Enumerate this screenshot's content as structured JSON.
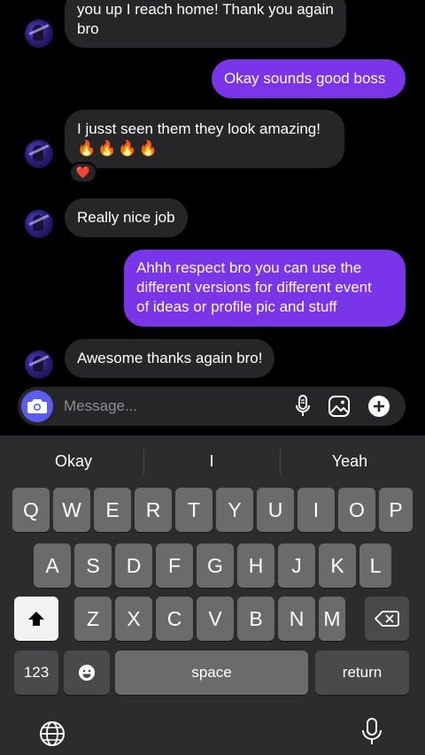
{
  "messages": [
    {
      "id": "m1",
      "side": "in",
      "lines": [
        "you up I reach home! Thank you again",
        "bro"
      ]
    },
    {
      "id": "m2",
      "side": "out",
      "lines": [
        "Okay sounds good boss"
      ]
    },
    {
      "id": "m3",
      "side": "in",
      "lines": [
        "I jusst seen them they look amazing!",
        "🔥🔥🔥🔥"
      ],
      "reaction": "❤️"
    },
    {
      "id": "m4",
      "side": "in",
      "lines": [
        "Really nice job"
      ]
    },
    {
      "id": "m5",
      "side": "out",
      "lines": [
        "Ahhh respect bro you can use the",
        "different versions for different event",
        "of ideas or profile pic and stuff"
      ]
    },
    {
      "id": "m6",
      "side": "in",
      "lines": [
        "Awesome thanks again bro!"
      ]
    }
  ],
  "composer": {
    "placeholder": "Message...",
    "icons": [
      "camera-icon",
      "microphone-icon",
      "gallery-icon",
      "plus-icon"
    ]
  },
  "keyboard": {
    "suggestions": [
      "Okay",
      "I",
      "Yeah"
    ],
    "row1": [
      "Q",
      "W",
      "E",
      "R",
      "T",
      "Y",
      "U",
      "I",
      "O",
      "P"
    ],
    "row2": [
      "A",
      "S",
      "D",
      "F",
      "G",
      "H",
      "J",
      "K",
      "L"
    ],
    "row3": [
      "Z",
      "X",
      "C",
      "V",
      "B",
      "N",
      "M"
    ],
    "numbers_label": "123",
    "space_label": "space",
    "return_label": "return",
    "icons": [
      "shift-icon",
      "backspace-icon",
      "emoji-icon",
      "globe-icon",
      "dictation-icon"
    ]
  },
  "colors": {
    "outgoing_bubble": "#7a35e8",
    "incoming_bubble": "#262628",
    "camera_button": "#5b5cf0",
    "keyboard_bg": "#2c2c2e"
  }
}
